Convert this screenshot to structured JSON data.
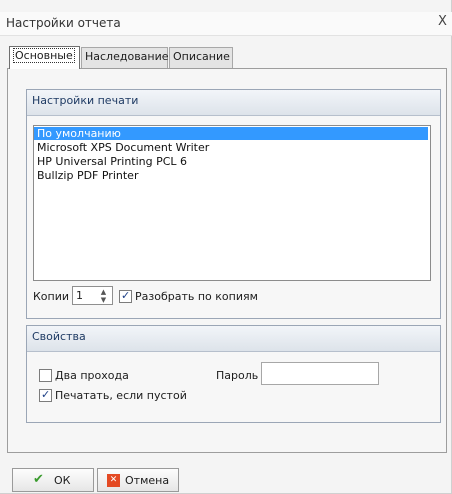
{
  "window": {
    "title": "Настройки отчета",
    "close_glyph": "X"
  },
  "tabs": [
    {
      "label": "Основные"
    },
    {
      "label": "Наследование"
    },
    {
      "label": "Описание"
    }
  ],
  "print_settings": {
    "header": "Настройки печати",
    "printers": [
      "По умолчанию",
      "Microsoft XPS Document Writer",
      "HP Universal Printing PCL 6",
      "Bullzip PDF Printer"
    ],
    "selected_printer": "По умолчанию",
    "copies_label": "Копии",
    "copies_value": "1",
    "collate_label": "Разобрать по копиям",
    "collate_checked": true
  },
  "properties": {
    "header": "Свойства",
    "two_pass_label": "Два прохода",
    "two_pass_checked": false,
    "print_if_empty_label": "Печатать, если пустой",
    "print_if_empty_checked": true,
    "password_label": "Пароль",
    "password_value": ""
  },
  "buttons": {
    "ok_label": "ОК",
    "ok_icon": "checkmark-icon",
    "cancel_label": "Отмена",
    "cancel_icon": "x-box-icon"
  },
  "colors": {
    "selection": "#3399ff",
    "panel_header_text": "#1e3a63",
    "cancel_icon": "#e44a24",
    "ok_icon": "#3a9b2e"
  }
}
